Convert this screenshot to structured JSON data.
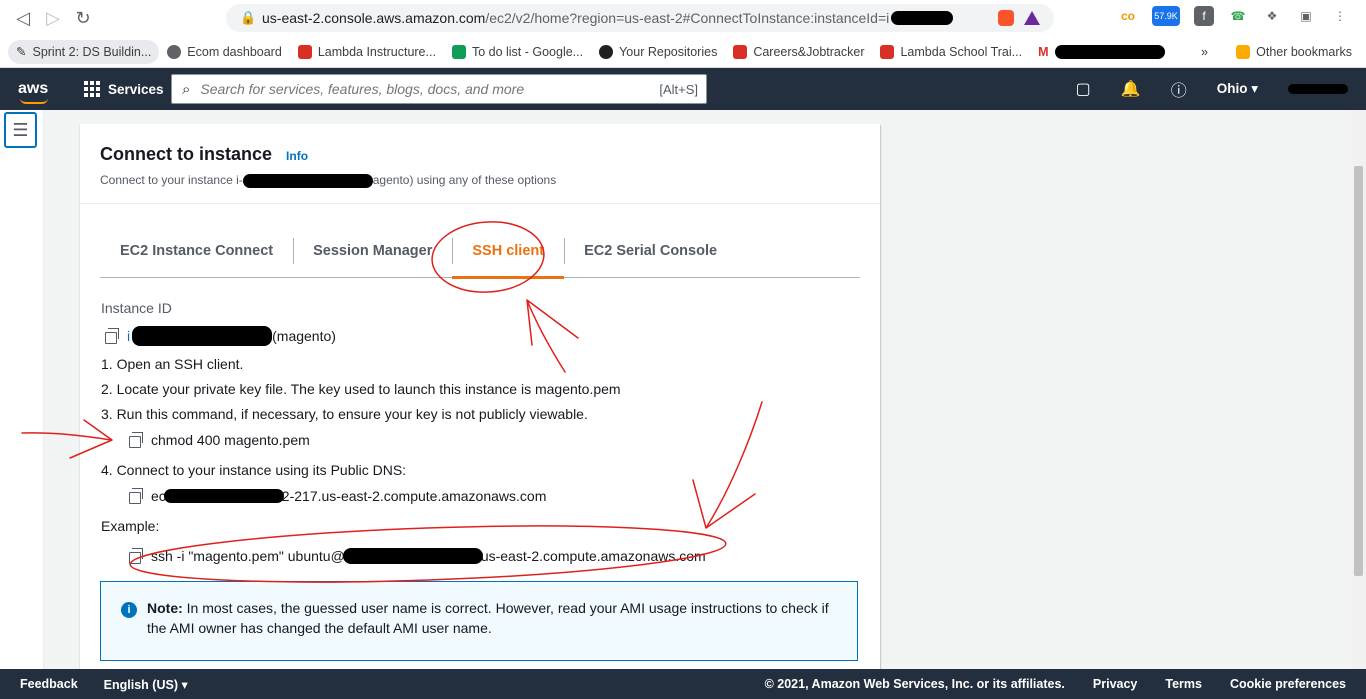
{
  "browser": {
    "url_host": "us-east-2.console.aws.amazon.com",
    "url_path": "/ec2/v2/home?region=us-east-2#ConnectToInstance:instanceId=i",
    "ext_badge_count": "57.9K",
    "brave_badge": "2",
    "bookmarks": [
      {
        "label": "Sprint 2: DS Buildin...",
        "color": "#3c4043"
      },
      {
        "label": "Ecom dashboard",
        "color": "#5f6368"
      },
      {
        "label": "Lambda Instructure...",
        "color": "#d93025"
      },
      {
        "label": "To do list - Google...",
        "color": "#0f9d58"
      },
      {
        "label": "Your Repositories",
        "color": "#202124"
      },
      {
        "label": "Careers&Jobtracker",
        "color": "#d93025"
      },
      {
        "label": "Lambda School Trai...",
        "color": "#d93025"
      }
    ],
    "gmail_label": "M",
    "overflow": "»",
    "other_bookmarks": "Other bookmarks"
  },
  "awsnav": {
    "logo": "aws",
    "services": "Services",
    "search_placeholder": "Search for services, features, blogs, docs, and more",
    "search_shortcut": "[Alt+S]",
    "region": "Ohio ▾"
  },
  "card": {
    "title": "Connect to instance",
    "info": "Info",
    "subtitle_prefix": "Connect to your instance i-",
    "subtitle_suffix": "agento) using any of these options"
  },
  "tabs": [
    {
      "label": "EC2 Instance Connect",
      "active": false
    },
    {
      "label": "Session Manager",
      "active": false
    },
    {
      "label": "SSH client",
      "active": true
    },
    {
      "label": "EC2 Serial Console",
      "active": false
    }
  ],
  "ssh": {
    "instance_id_label": "Instance ID",
    "instance_id_prefix": "i",
    "instance_id_suffix": "(magento)",
    "step1": "1. Open an SSH client.",
    "step2": "2. Locate your private key file. The key used to launch this instance is magento.pem",
    "step3": "3. Run this command, if necessary, to ensure your key is not publicly viewable.",
    "chmod_cmd": "chmod 400 magento.pem",
    "step4": "4. Connect to your instance using its Public DNS:",
    "dns_prefix": "ec",
    "dns_suffix": "2-217.us-east-2.compute.amazonaws.com",
    "example_label": "Example:",
    "example_prefix": "ssh -i \"magento.pem\" ubuntu@",
    "example_suffix": "us-east-2.compute.amazonaws.com",
    "note_bold": "Note:",
    "note_text": " In most cases, the guessed user name is correct. However, read your AMI usage instructions to check if the AMI owner has changed the default AMI user name."
  },
  "footer": {
    "feedback": "Feedback",
    "language": "English (US) ▾",
    "copyright": "© 2021, Amazon Web Services, Inc. or its affiliates.",
    "privacy": "Privacy",
    "terms": "Terms",
    "cookies": "Cookie preferences"
  },
  "colors": {
    "aws_nav": "#232f3e",
    "aws_orange": "#ec7211",
    "link_blue": "#0073bb",
    "annotation_red": "#e0201a"
  }
}
